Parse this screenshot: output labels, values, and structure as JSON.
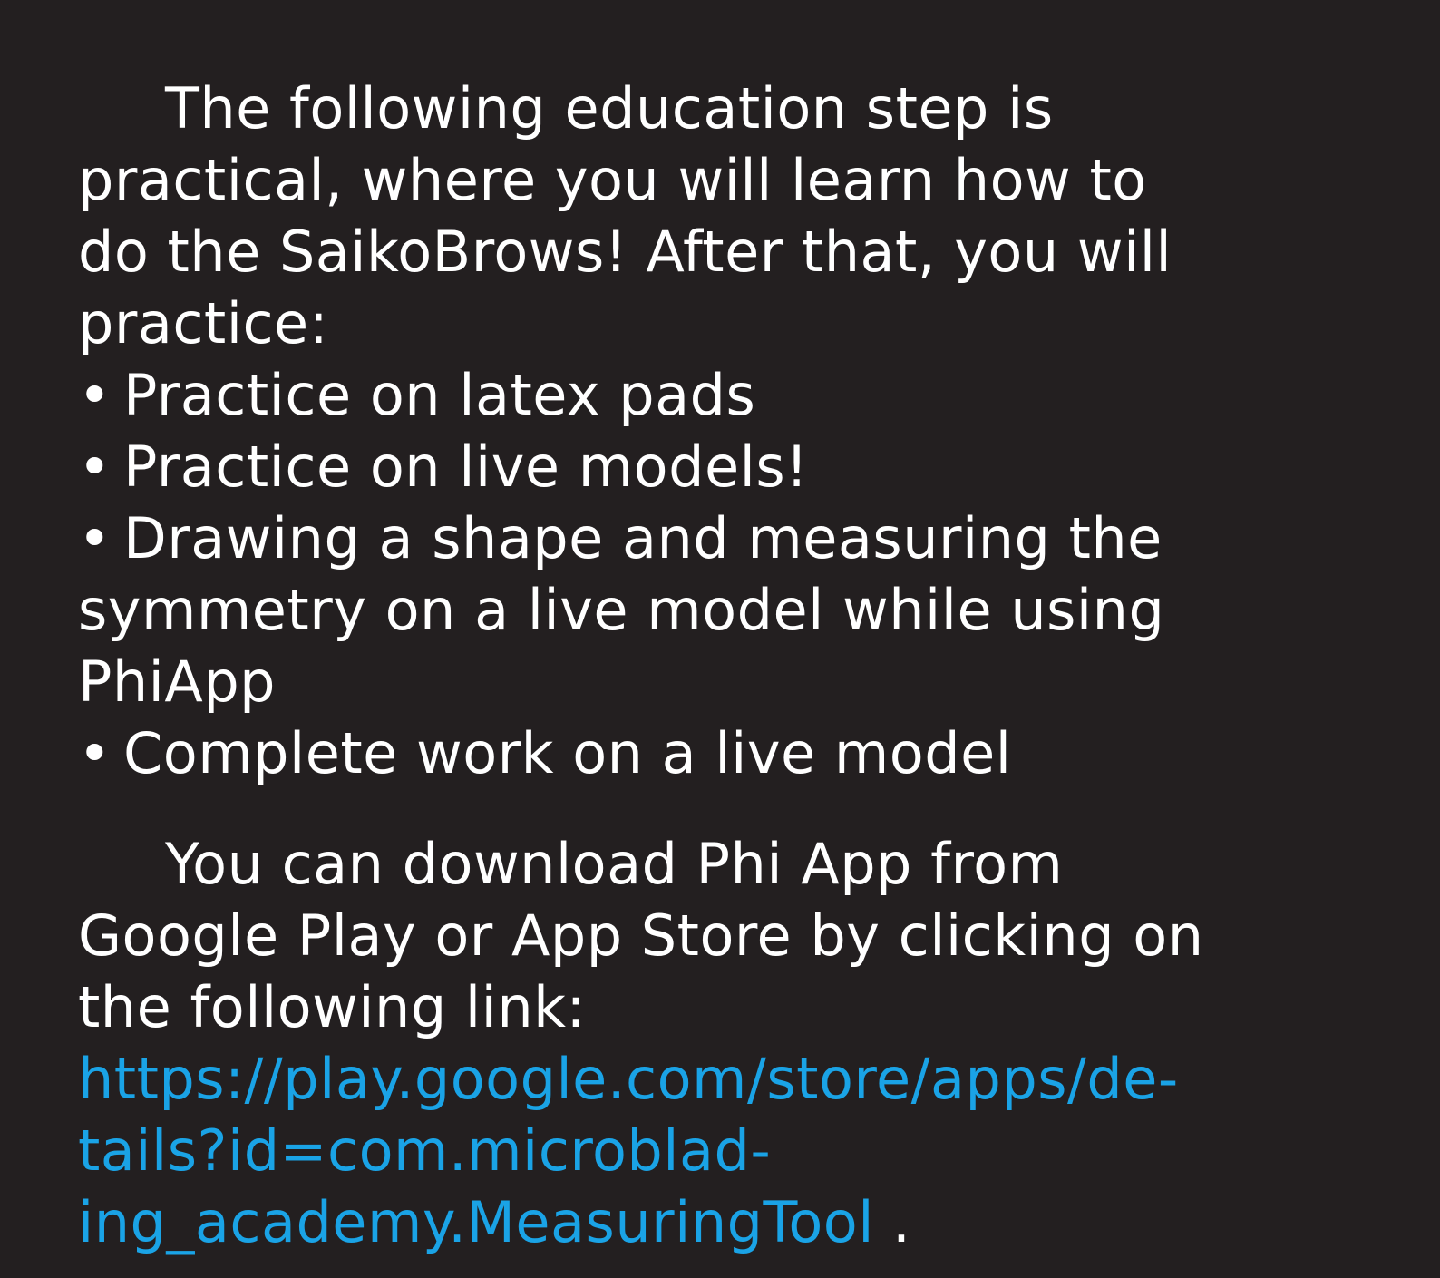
{
  "paragraph1": {
    "lines": [
      "The following education step is",
      "practical, where you will learn how to",
      "do the SaikoBrows! After that, you will",
      "practice:"
    ]
  },
  "bullet_marker": "•",
  "bullets": [
    {
      "lines": [
        "Practice on latex pads"
      ]
    },
    {
      "lines": [
        "Practice on live models!"
      ]
    },
    {
      "lines": [
        "Drawing a shape and measuring the",
        "symmetry on a live model while using",
        "PhiApp"
      ]
    },
    {
      "lines": [
        "Complete work on a live model"
      ]
    }
  ],
  "paragraph2": {
    "lines": [
      "You can download Phi App from",
      "Google Play or App Store by clicking on",
      "the following link:"
    ]
  },
  "link": {
    "lines": [
      "https://play.google.com/store/apps/de-",
      "tails?id=com.microblad-",
      "ing_academy.MeasuringTool"
    ],
    "trailing": " ."
  },
  "colors": {
    "background": "#231f20",
    "text": "#ffffff",
    "link": "#1aa3e6"
  }
}
